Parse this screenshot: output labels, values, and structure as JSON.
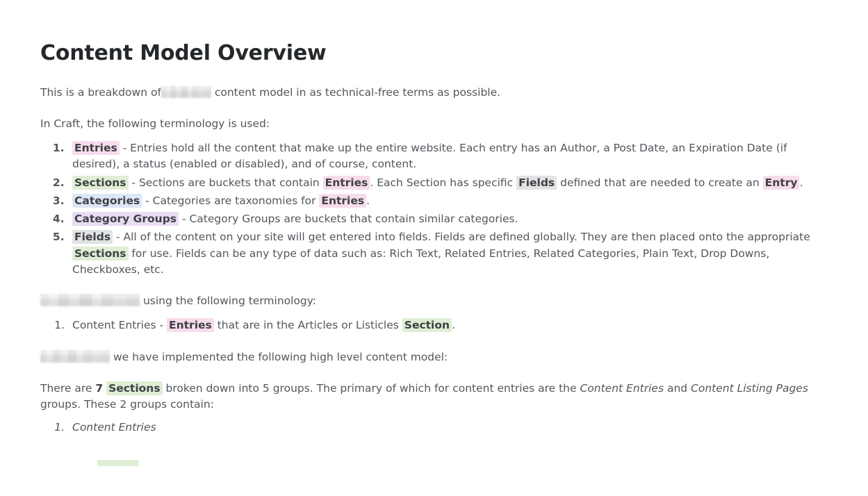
{
  "document": {
    "title": "Content Model Overview",
    "intro": {
      "before_redaction": "This is a breakdown of",
      "redaction": "[redacted]",
      "after_redaction": "content model in as technical-free terms as possible."
    },
    "craft_terminology": {
      "lead_in": "In Craft, the following terminology is used:",
      "items": [
        {
          "term": "Entries",
          "term_highlight": "pink",
          "text_parts": [
            {
              "type": "text",
              "value": " - Entries hold all the content that make up the entire website. Each entry has an Author, a Post Date, an Expiration Date (if desired), a status (enabled or disabled), and of course, content."
            }
          ]
        },
        {
          "term": "Sections",
          "term_highlight": "green",
          "text_parts": [
            {
              "type": "text",
              "value": " - Sections are buckets that contain "
            },
            {
              "type": "highlight",
              "value": "Entries",
              "color": "pink"
            },
            {
              "type": "text",
              "value": ". Each Section has specific "
            },
            {
              "type": "highlight",
              "value": "Fields",
              "color": "gray"
            },
            {
              "type": "text",
              "value": " defined that are needed to create an "
            },
            {
              "type": "highlight",
              "value": "Entry",
              "color": "pink"
            },
            {
              "type": "text",
              "value": "."
            }
          ]
        },
        {
          "term": "Categories",
          "term_highlight": "blue",
          "text_parts": [
            {
              "type": "text",
              "value": " - Categories are taxonomies for "
            },
            {
              "type": "highlight",
              "value": "Entries",
              "color": "pink"
            },
            {
              "type": "text",
              "value": "."
            }
          ]
        },
        {
          "term": "Category Groups",
          "term_highlight": "purple",
          "text_parts": [
            {
              "type": "text",
              "value": " - Category Groups are buckets that contain similar categories."
            }
          ]
        },
        {
          "term": "Fields",
          "term_highlight": "gray",
          "text_parts": [
            {
              "type": "text",
              "value": " - All of the content on your site will get entered into fields. Fields are defined globally. They are then placed onto the appropriate "
            },
            {
              "type": "highlight",
              "value": "Sections",
              "color": "green"
            },
            {
              "type": "text",
              "value": " for use. Fields can be any type of data such as: Rich Text, Related Entries, Related Categories, Plain Text, Drop Downs, Checkboxes, etc."
            }
          ]
        }
      ]
    },
    "site_terminology": {
      "redaction": "[redacted]",
      "lead_in": "using the following terminology:",
      "items": [
        {
          "text_parts": [
            {
              "type": "text",
              "value": "Content Entries - "
            },
            {
              "type": "highlight",
              "value": "Entries",
              "color": "pink"
            },
            {
              "type": "text",
              "value": " that are in the Articles or Listicles "
            },
            {
              "type": "highlight",
              "value": "Section",
              "color": "green"
            },
            {
              "type": "text",
              "value": "."
            }
          ]
        }
      ]
    },
    "implementation": {
      "redaction": "[redacted]",
      "lead_in": "we have implemented the following high level content model:"
    },
    "sections_summary": {
      "part_1": "There are ",
      "count": "7",
      "sections_term": "Sections",
      "sections_highlight": "green",
      "part_2": " broken down into 5 groups. The primary of which for content entries are the ",
      "group_1": "Content Entries",
      "part_3": " and ",
      "group_2": "Content Listing Pages",
      "part_4": " groups. These 2 groups contain:",
      "items": [
        {
          "label": "Content Entries"
        }
      ]
    }
  },
  "colors": {
    "pink": "#f7dcec",
    "green": "#dfeed4",
    "blue": "#dbe7f6",
    "purple": "#e9dcf3",
    "gray": "#e2e3e4",
    "text": "#52575c",
    "heading": "#25282b",
    "background": "#ffffff"
  }
}
